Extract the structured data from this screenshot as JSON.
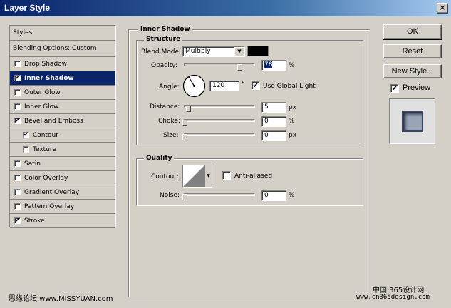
{
  "window": {
    "title": "Layer Style",
    "close_label": "×"
  },
  "styles_list": {
    "header": "Styles",
    "blending_options": "Blending Options: Custom",
    "items": [
      {
        "label": "Drop Shadow",
        "checked": false,
        "selected": false,
        "sub": false
      },
      {
        "label": "Inner Shadow",
        "checked": true,
        "selected": true,
        "sub": false
      },
      {
        "label": "Outer Glow",
        "checked": false,
        "selected": false,
        "sub": false
      },
      {
        "label": "Inner Glow",
        "checked": false,
        "selected": false,
        "sub": false
      },
      {
        "label": "Bevel and Emboss",
        "checked": true,
        "selected": false,
        "sub": false
      },
      {
        "label": "Contour",
        "checked": true,
        "selected": false,
        "sub": true
      },
      {
        "label": "Texture",
        "checked": false,
        "selected": false,
        "sub": true
      },
      {
        "label": "Satin",
        "checked": false,
        "selected": false,
        "sub": false
      },
      {
        "label": "Color Overlay",
        "checked": false,
        "selected": false,
        "sub": false
      },
      {
        "label": "Gradient Overlay",
        "checked": false,
        "selected": false,
        "sub": false
      },
      {
        "label": "Pattern Overlay",
        "checked": false,
        "selected": false,
        "sub": false
      },
      {
        "label": "Stroke",
        "checked": true,
        "selected": false,
        "sub": false
      }
    ]
  },
  "inner_shadow": {
    "title": "Inner Shadow",
    "structure": {
      "title": "Structure",
      "blend_mode_label": "Blend Mode:",
      "blend_mode_value": "Multiply",
      "shadow_color": "#000000",
      "opacity_label": "Opacity:",
      "opacity_value": "78",
      "opacity_unit": "%",
      "opacity_fraction": 0.78,
      "angle_label": "Angle:",
      "angle_value": "120",
      "angle_unit": "°",
      "use_global_light_label": "Use Global Light",
      "use_global_light": true,
      "distance_label": "Distance:",
      "distance_value": "5",
      "distance_unit": "px",
      "distance_fraction": 0.02,
      "choke_label": "Choke:",
      "choke_value": "0",
      "choke_unit": "%",
      "size_label": "Size:",
      "size_value": "0",
      "size_unit": "px"
    },
    "quality": {
      "title": "Quality",
      "contour_label": "Contour:",
      "anti_aliased_label": "Anti-aliased",
      "anti_aliased": false,
      "noise_label": "Noise:",
      "noise_value": "0",
      "noise_unit": "%"
    }
  },
  "buttons": {
    "ok": "OK",
    "reset": "Reset",
    "new_style": "New Style...",
    "preview_label": "Preview",
    "preview_checked": true
  },
  "watermarks": {
    "left": "思缘论坛  www.MISSYUAN.com",
    "right_top": "中国·365设计网",
    "right_bottom": "www.cn365design.com"
  },
  "colors": {
    "titlebar_start": "#0a246a",
    "selection": "#0a246a",
    "dialog_bg": "#d4d0c8"
  }
}
